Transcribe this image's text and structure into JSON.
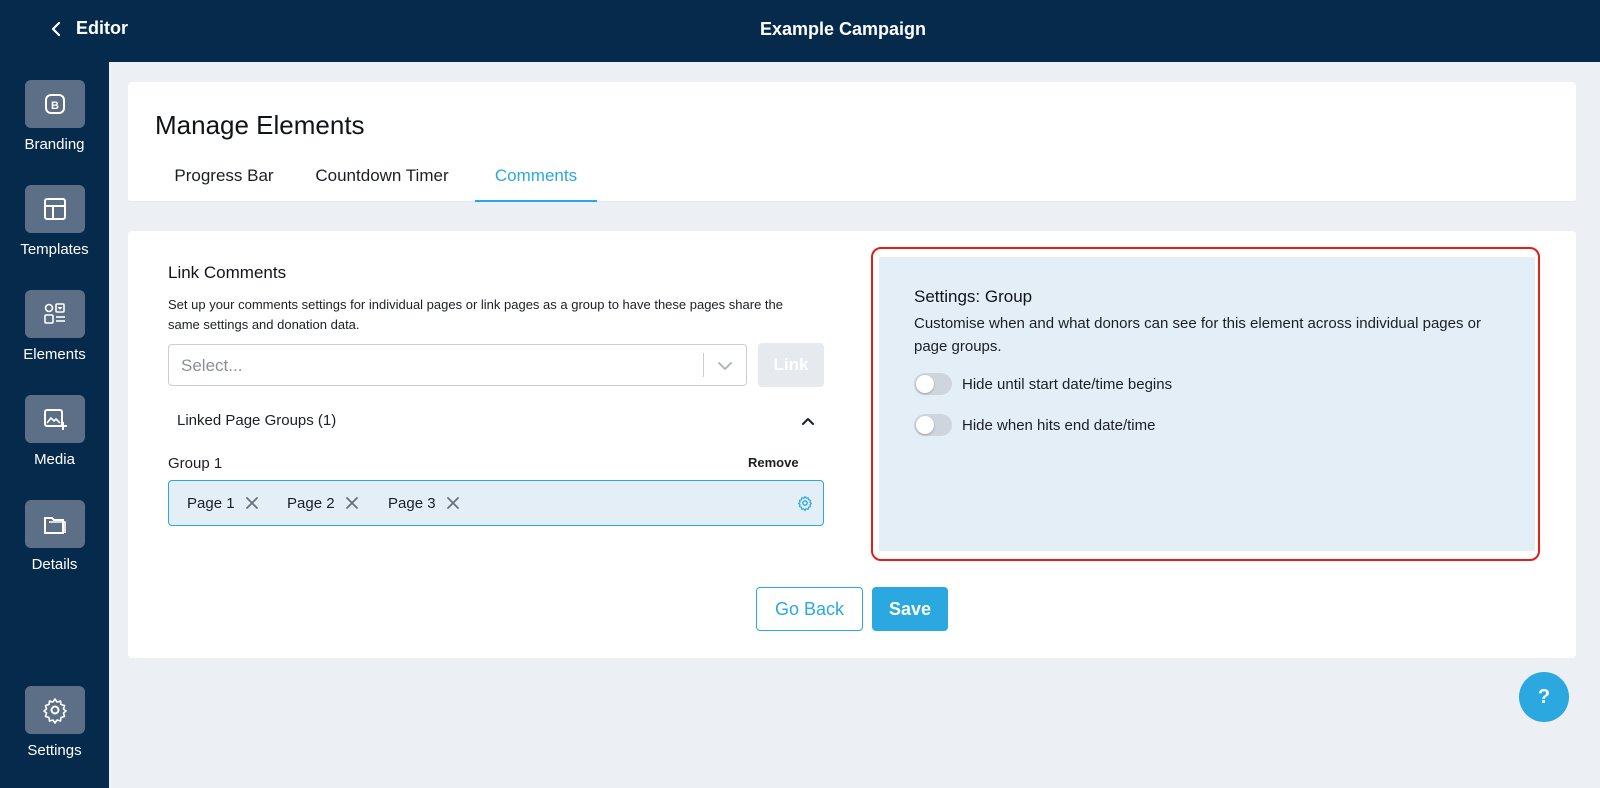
{
  "topbar": {
    "back_label": "Editor",
    "campaign_title": "Example Campaign"
  },
  "sidebar": {
    "items": [
      {
        "label": "Branding",
        "icon": "branding-icon"
      },
      {
        "label": "Templates",
        "icon": "templates-icon"
      },
      {
        "label": "Elements",
        "icon": "elements-icon"
      },
      {
        "label": "Media",
        "icon": "media-icon"
      },
      {
        "label": "Details",
        "icon": "details-icon"
      },
      {
        "label": "Settings",
        "icon": "gear-icon"
      }
    ]
  },
  "header": {
    "title": "Manage Elements",
    "tabs": [
      {
        "label": "Progress Bar",
        "active": false
      },
      {
        "label": "Countdown Timer",
        "active": false
      },
      {
        "label": "Comments",
        "active": true
      }
    ]
  },
  "link_comments": {
    "title": "Link Comments",
    "description": "Set up your comments settings for individual pages or link pages as a group to have these pages share the same settings and donation data.",
    "select_placeholder": "Select...",
    "link_button": "Link",
    "linked_groups_label": "Linked Page Groups (1)",
    "group": {
      "label": "Group 1",
      "remove_label": "Remove",
      "pages": [
        "Page 1",
        "Page 2",
        "Page 3"
      ]
    }
  },
  "settings": {
    "title": "Settings: Group",
    "description": "Customise when and what donors can see for this element across individual pages or page groups.",
    "toggles": [
      {
        "label": "Hide until start date/time begins",
        "on": false
      },
      {
        "label": "Hide when hits end date/time",
        "on": false
      }
    ]
  },
  "actions": {
    "go_back": "Go Back",
    "save": "Save"
  },
  "help_label": "?",
  "colors": {
    "navy": "#062a4b",
    "accent": "#2ba8e0",
    "highlight": "#e0201a",
    "panel": "#e4eef7"
  }
}
